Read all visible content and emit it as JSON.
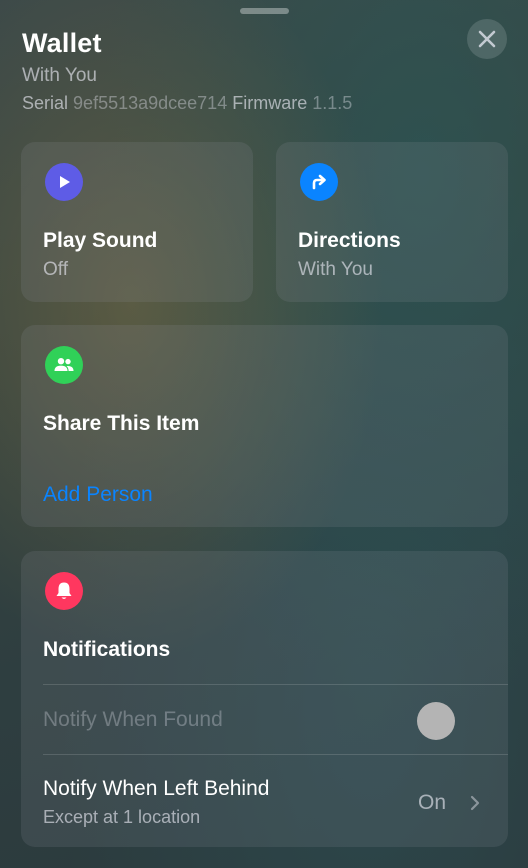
{
  "header": {
    "title": "Wallet",
    "subtitle": "With You",
    "serial_label": "Serial",
    "serial_value": "9ef5513a9dcee714",
    "firmware_label": "Firmware",
    "firmware_value": "1.1.5",
    "close_icon": "close-icon"
  },
  "actions": {
    "play_sound": {
      "label": "Play Sound",
      "value": "Off",
      "icon": "play-icon",
      "icon_color": "#5e5ce6"
    },
    "directions": {
      "label": "Directions",
      "value": "With You",
      "icon": "directions-arrow-icon",
      "icon_color": "#0a84ff"
    }
  },
  "share": {
    "label": "Share This Item",
    "link": "Add Person",
    "icon": "people-icon",
    "icon_color": "#30d158"
  },
  "notifications": {
    "label": "Notifications",
    "icon": "bell-icon",
    "icon_color": "#ff375f",
    "rows": [
      {
        "label": "Notify When Found",
        "enabled": false
      },
      {
        "label": "Notify When Left Behind",
        "sublabel": "Except at 1 location",
        "value": "On"
      }
    ]
  }
}
